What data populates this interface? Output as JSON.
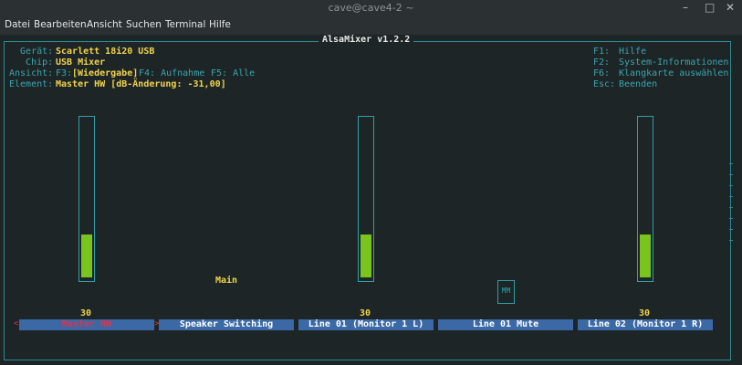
{
  "window": {
    "title": "cave@cave4-2 ~",
    "btn_minimize": "–",
    "btn_maximize": "□",
    "btn_close": "✕"
  },
  "menu": {
    "items": [
      "Datei",
      "Bearbeiten",
      "Ansicht",
      "Suchen",
      "Terminal",
      "Hilfe"
    ]
  },
  "alsamixer": {
    "title": "AlsaMixer v1.2.2",
    "info": {
      "geraet_label": "  Gerät:",
      "geraet_value": "Scarlett 18i20 USB",
      "chip_label": "   Chip:",
      "chip_value": "USB Mixer",
      "ansicht_label": "Ansicht:",
      "ansicht_f3": "F3:",
      "ansicht_f3_value": "[Wiedergabe]",
      "ansicht_f4": "F4: Aufnahme",
      "ansicht_f5": "F5: Alle",
      "element_label": "Element:",
      "element_value": "Master HW [dB-Änderung: -31,00]"
    },
    "help": [
      {
        "key": "F1:",
        "text": "Hilfe"
      },
      {
        "key": "F2:",
        "text": "System-Informationen"
      },
      {
        "key": "F6:",
        "text": "Klangkarte auswählen"
      },
      {
        "key": "Esc:",
        "text": "Beenden"
      }
    ],
    "main_label": "Main",
    "mute_indicator": "MM",
    "sel_left": "<",
    "sel_right": ">",
    "controls": [
      {
        "name": "Master HW",
        "value": "30",
        "level": 0.26,
        "selected": true
      },
      {
        "name": "Speaker Switching",
        "value": "",
        "selected": false
      },
      {
        "name": "Line 01 (Monitor 1 L)",
        "value": "30",
        "level": 0.26,
        "selected": false
      },
      {
        "name": "Line 01 Mute",
        "value": "",
        "selected": false
      },
      {
        "name": "Line 02 (Monitor 1 R)",
        "value": "30",
        "level": 0.26,
        "selected": false
      }
    ]
  }
}
